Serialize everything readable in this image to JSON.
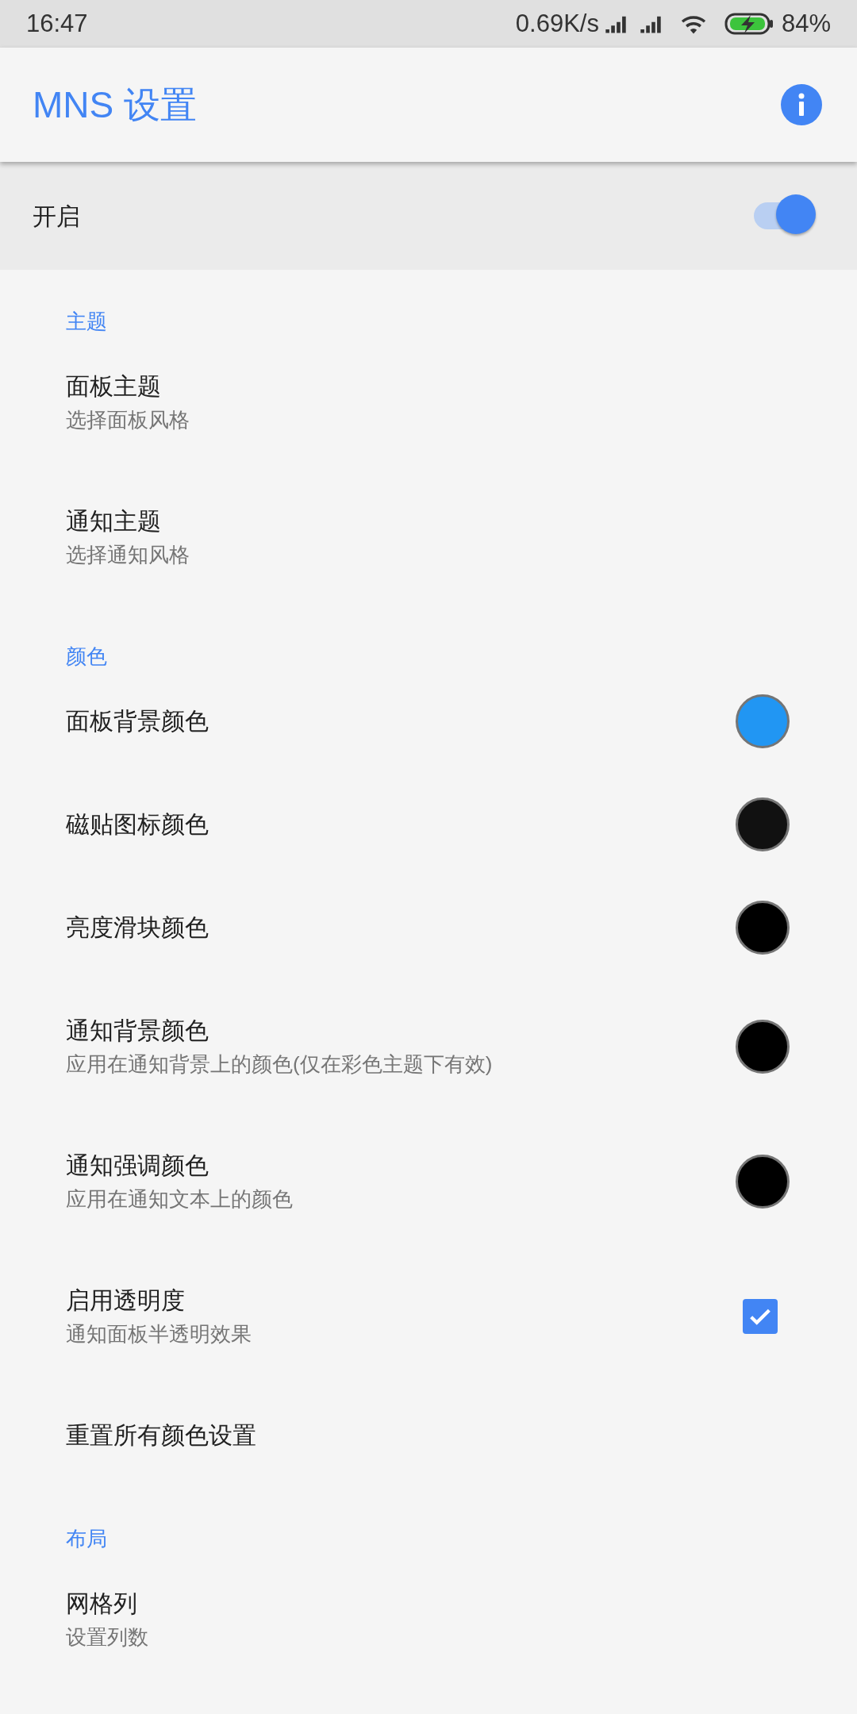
{
  "status_bar": {
    "time": "16:47",
    "speed": "0.69K/s",
    "battery": "84%"
  },
  "app_bar": {
    "title": "MNS 设置"
  },
  "master_switch": {
    "label": "开启",
    "on": true
  },
  "sections": [
    {
      "title": "主题",
      "items": [
        {
          "kind": "text",
          "title": "面板主题",
          "subtitle": "选择面板风格"
        },
        {
          "kind": "text",
          "title": "通知主题",
          "subtitle": "选择通知风格"
        }
      ]
    },
    {
      "title": "颜色",
      "items": [
        {
          "kind": "color",
          "title": "面板背景颜色",
          "color": "#2196f3"
        },
        {
          "kind": "color",
          "title": "磁贴图标颜色",
          "color": "#111111"
        },
        {
          "kind": "color",
          "title": "亮度滑块颜色",
          "color": "#000000"
        },
        {
          "kind": "color",
          "title": "通知背景颜色",
          "subtitle": "应用在通知背景上的颜色(仅在彩色主题下有效)",
          "color": "#000000"
        },
        {
          "kind": "color",
          "title": "通知强调颜色",
          "subtitle": "应用在通知文本上的颜色",
          "color": "#000000"
        },
        {
          "kind": "checkbox",
          "title": "启用透明度",
          "subtitle": "通知面板半透明效果",
          "checked": true
        },
        {
          "kind": "text",
          "title": "重置所有颜色设置"
        }
      ]
    },
    {
      "title": "布局",
      "items": [
        {
          "kind": "text",
          "title": "网格列",
          "subtitle": "设置列数"
        }
      ]
    }
  ]
}
